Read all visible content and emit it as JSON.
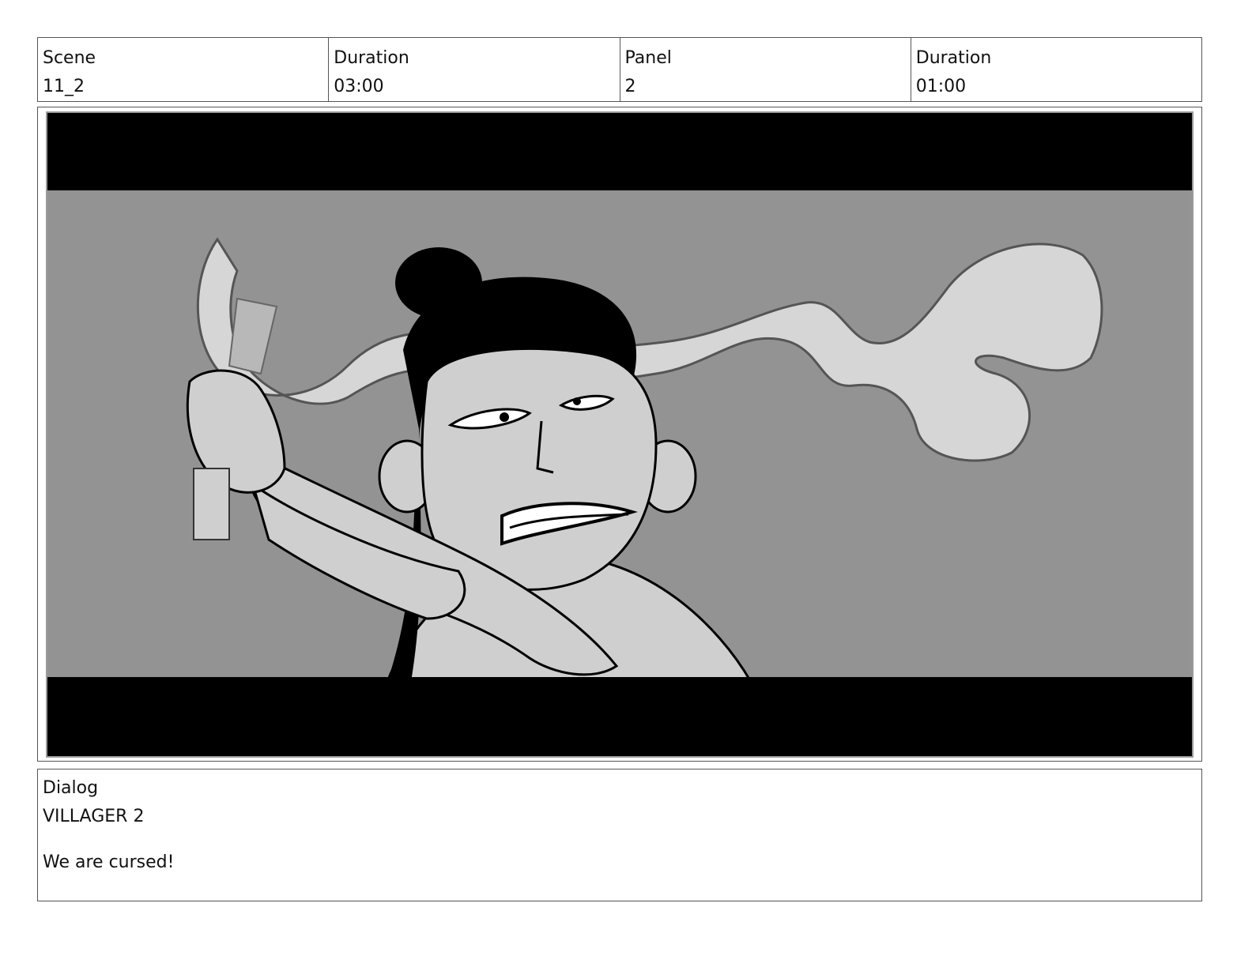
{
  "header": {
    "scene_label": "Scene",
    "scene_value": "11_2",
    "scene_duration_label": "Duration",
    "scene_duration_value": "03:00",
    "panel_label": "Panel",
    "panel_value": "2",
    "panel_duration_label": "Duration",
    "panel_duration_value": "01:00"
  },
  "panel": {
    "image_icon": "storyboard-sketch-villager-with-smoke"
  },
  "dialog": {
    "label": "Dialog",
    "speaker": "VILLAGER 2",
    "line": "We are cursed!"
  },
  "colors": {
    "letterbox": "#000000",
    "background": "#939393",
    "figure": "#cfcfcf",
    "smoke": "#d6d6d6",
    "ink": "#000000"
  }
}
